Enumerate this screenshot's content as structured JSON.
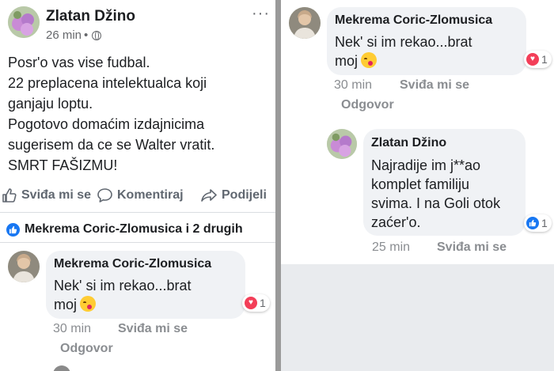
{
  "post": {
    "author": "Zlatan Džino",
    "time": "26 min",
    "dot": "•",
    "more": "···",
    "body_lines": [
      "Posr'o vas vise fudbal.",
      "22 preplacena intelektualca koji",
      "ganjaju loptu.",
      "Pogotovo domaćim izdajnicima",
      "sugerisem da ce se Walter vratit.",
      "SMRT FAŠIZMU!"
    ],
    "actions": {
      "like": "Sviđa mi se",
      "comment": "Komentiraj",
      "share": "Podijeli"
    },
    "likers": "Mekrema Coric-Zlomusica i 2 drugih"
  },
  "comments_left": [
    {
      "author": "Mekrema Coric-Zlomusica",
      "line1": "Nek' si im rekao...brat",
      "line2": "moj",
      "reaction_count": "1",
      "time": "30 min",
      "like": "Sviđa mi se",
      "reply": "Odgovor"
    }
  ],
  "comments_right": [
    {
      "author": "Mekrema Coric-Zlomusica",
      "line1": "Nek' si im rekao...brat",
      "line2": "moj",
      "reaction_count": "1",
      "time": "30 min",
      "like": "Sviđa mi se",
      "reply": "Odgovor"
    },
    {
      "author": "Zlatan Džino",
      "lines": [
        "Najradije im j**ao",
        "komplet familiju",
        "svima. I na Goli otok",
        "zaćer'o."
      ],
      "reaction_count": "1",
      "time": "25 min",
      "like": "Sviđa mi se"
    }
  ],
  "colors": {
    "like_blue": "#1877f2",
    "love_red": "#f33e58",
    "bubble": "#f0f2f5",
    "meta_gray": "#8a8d91"
  }
}
